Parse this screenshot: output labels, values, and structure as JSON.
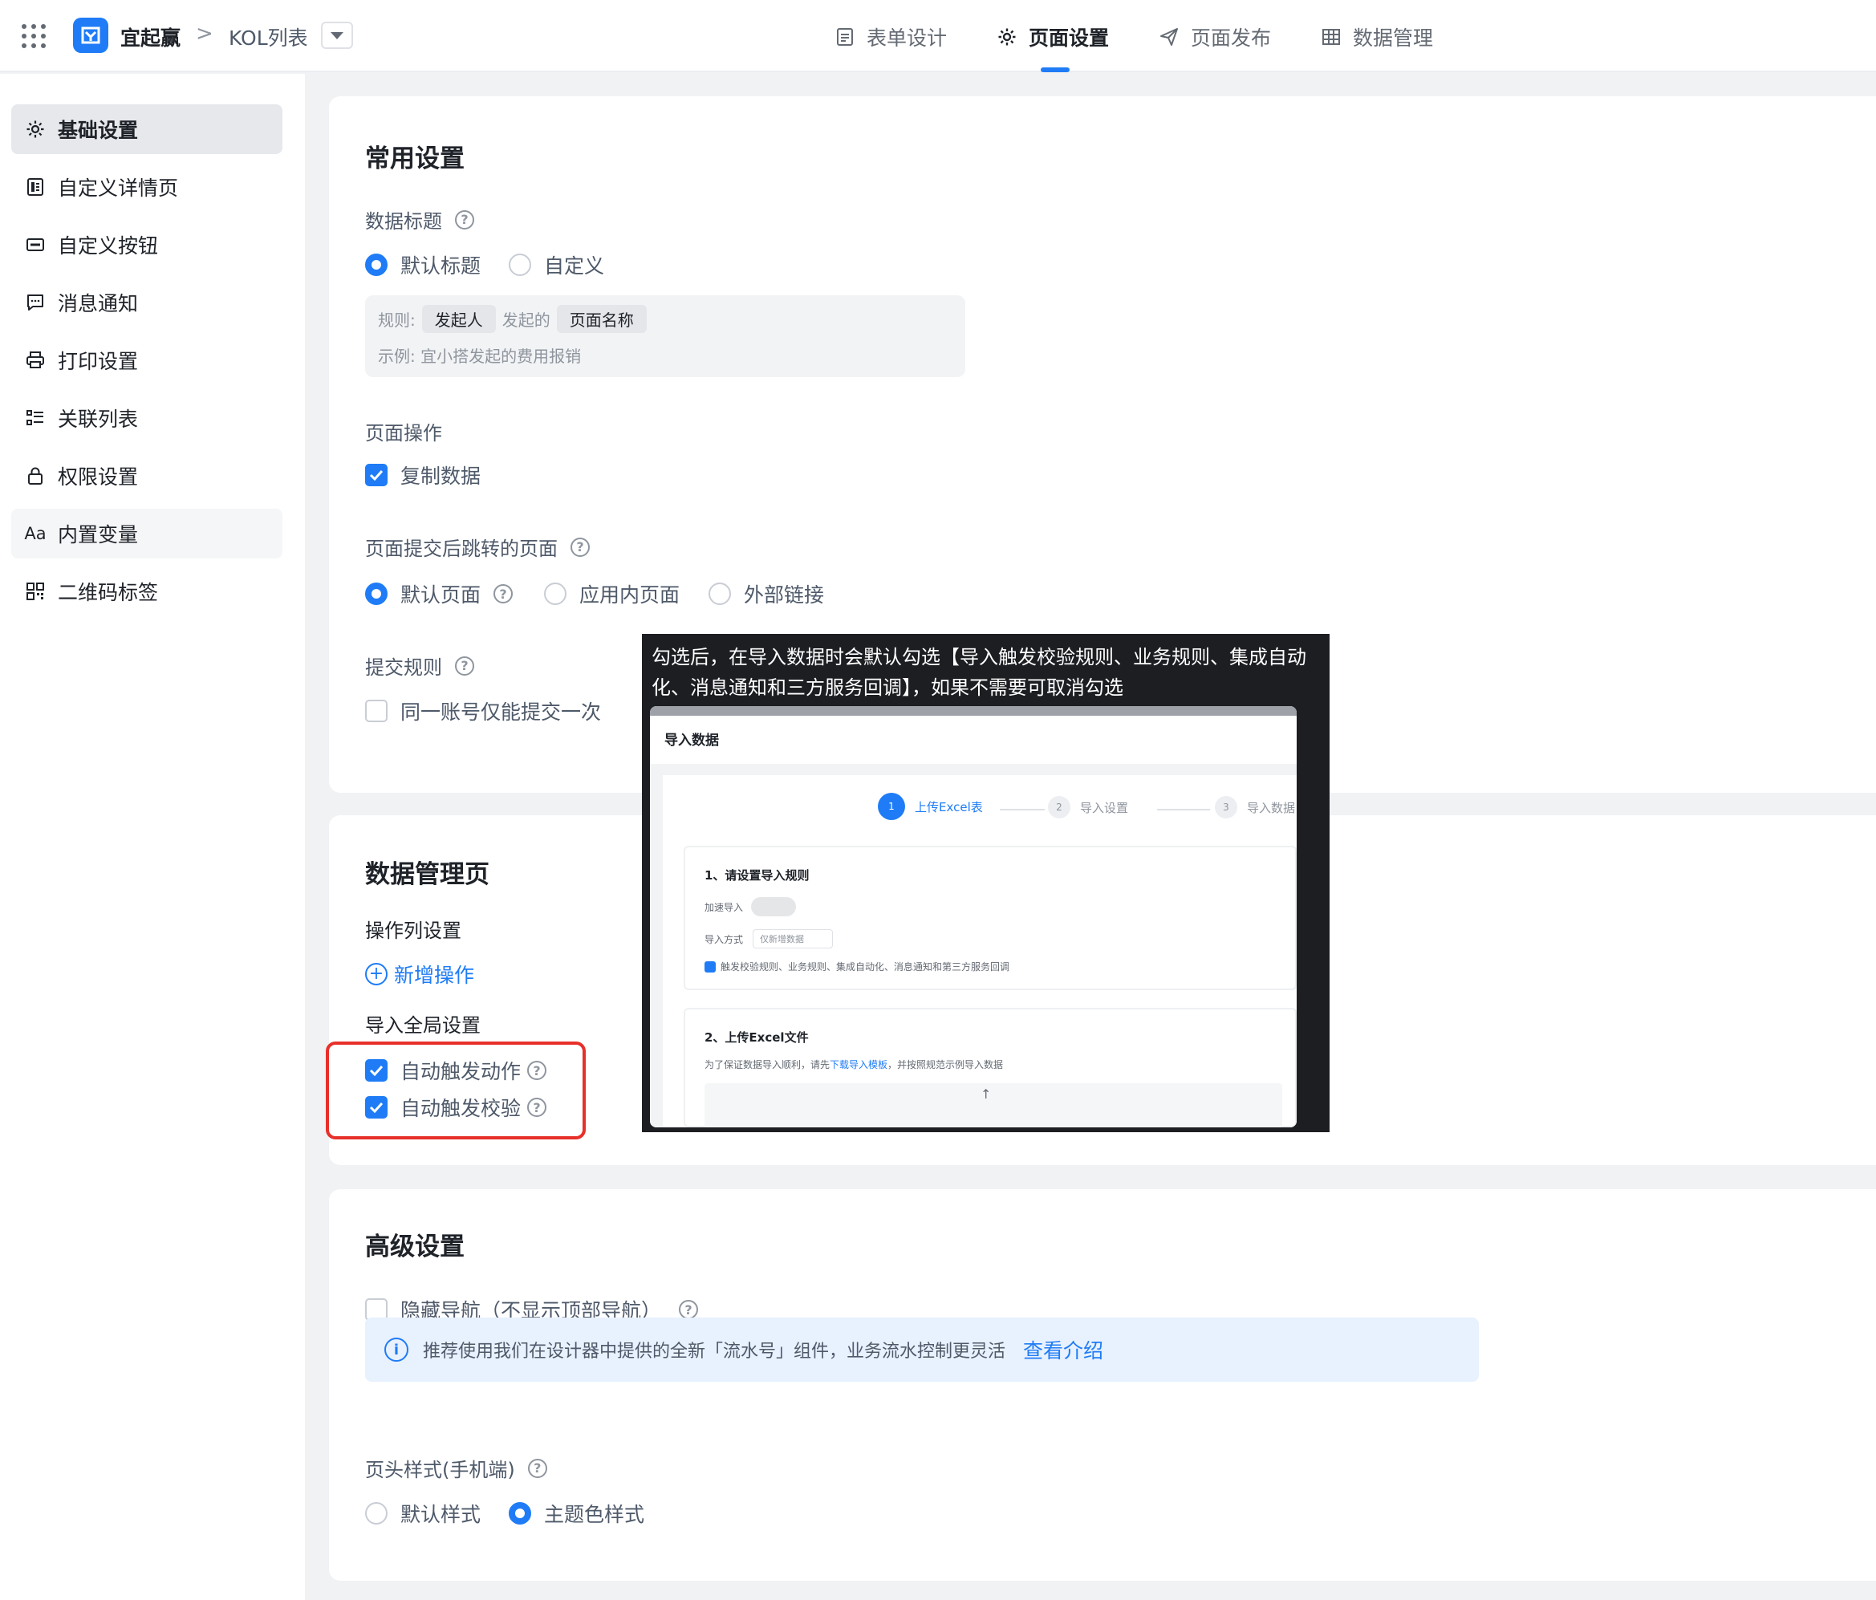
{
  "topbar": {
    "app_name": "宜起赢",
    "breadcrumb_sep": ">",
    "page_name": "KOL列表",
    "tabs": [
      {
        "label": "表单设计",
        "icon": "document-icon"
      },
      {
        "label": "页面设置",
        "icon": "gear-icon"
      },
      {
        "label": "页面发布",
        "icon": "send-icon"
      },
      {
        "label": "数据管理",
        "icon": "table-icon"
      }
    ],
    "active_tab": "页面设置"
  },
  "sidebar": {
    "items": [
      {
        "label": "基础设置",
        "icon": "gear-icon"
      },
      {
        "label": "自定义详情页",
        "icon": "detail-page-icon"
      },
      {
        "label": "自定义按钮",
        "icon": "button-icon"
      },
      {
        "label": "消息通知",
        "icon": "message-icon"
      },
      {
        "label": "打印设置",
        "icon": "printer-icon"
      },
      {
        "label": "关联列表",
        "icon": "list-icon"
      },
      {
        "label": "权限设置",
        "icon": "lock-icon"
      },
      {
        "label": "内置变量",
        "icon": "text-variable-icon"
      },
      {
        "label": "二维码标签",
        "icon": "qrcode-icon"
      }
    ],
    "active_item": "基础设置"
  },
  "common_settings": {
    "title": "常用设置",
    "data_title": {
      "label": "数据标题",
      "options": [
        "默认标题",
        "自定义"
      ],
      "selected": "默认标题",
      "rule_label": "规则:",
      "rule_tag_1": "发起人",
      "rule_mid": "发起的",
      "rule_tag_2": "页面名称",
      "example": "示例:  宜小搭发起的费用报销"
    },
    "page_actions": {
      "label": "页面操作",
      "copy_data": "复制数据",
      "copy_data_checked": true
    },
    "after_submit": {
      "label": "页面提交后跳转的页面",
      "options": [
        "默认页面",
        "应用内页面",
        "外部链接"
      ],
      "selected": "默认页面"
    },
    "submit_rules": {
      "label": "提交规则",
      "once_per_account": "同一账号仅能提交一次",
      "checked": false
    }
  },
  "data_manage": {
    "title": "数据管理页",
    "column_settings": "操作列设置",
    "add_action": "新增操作",
    "import_global": "导入全局设置",
    "auto_trigger_action": "自动触发动作",
    "auto_trigger_validate": "自动触发校验",
    "auto_trigger_action_checked": true,
    "auto_trigger_validate_checked": true
  },
  "advanced": {
    "title": "高级设置",
    "hide_nav": "隐藏导航（不显示顶部导航）",
    "hide_nav_checked": false,
    "info_text": "推荐使用我们在设计器中提供的全新「流水号」组件，业务流水控制更灵活",
    "info_link": "查看介绍",
    "header_style": {
      "label": "页头样式(手机端)",
      "options": [
        "默认样式",
        "主题色样式"
      ],
      "selected": "主题色样式"
    }
  },
  "tooltip": {
    "text": "勾选后，在导入数据时会默认勾选【导入触发校验规则、业务规则、集成自动化、消息通知和三方服务回调】，如果不需要可取消勾选",
    "preview": {
      "title": "导入数据",
      "steps": [
        "上传Excel表",
        "导入设置",
        "导入数据"
      ],
      "step_numbers": [
        "1",
        "2",
        "3"
      ],
      "section1_title": "1、请设置导入规则",
      "fast_import": "加速导入",
      "import_mode": "导入方式",
      "import_mode_value": "仅新增数据",
      "trigger_text": "触发校验规则、业务规则、集成自动化、消息通知和第三方服务回调",
      "section2_title": "2、上传Excel文件",
      "upload_hint_pre": "为了保证数据导入顺利，请先",
      "upload_hint_link": "下载导入模板",
      "upload_hint_post": "，并按照规范示例导入数据",
      "upload_arrow": "↑"
    }
  },
  "colors": {
    "primary": "#1f7cf6",
    "highlight_border": "#e8302a",
    "tooltip_bg": "#1d1e22"
  }
}
